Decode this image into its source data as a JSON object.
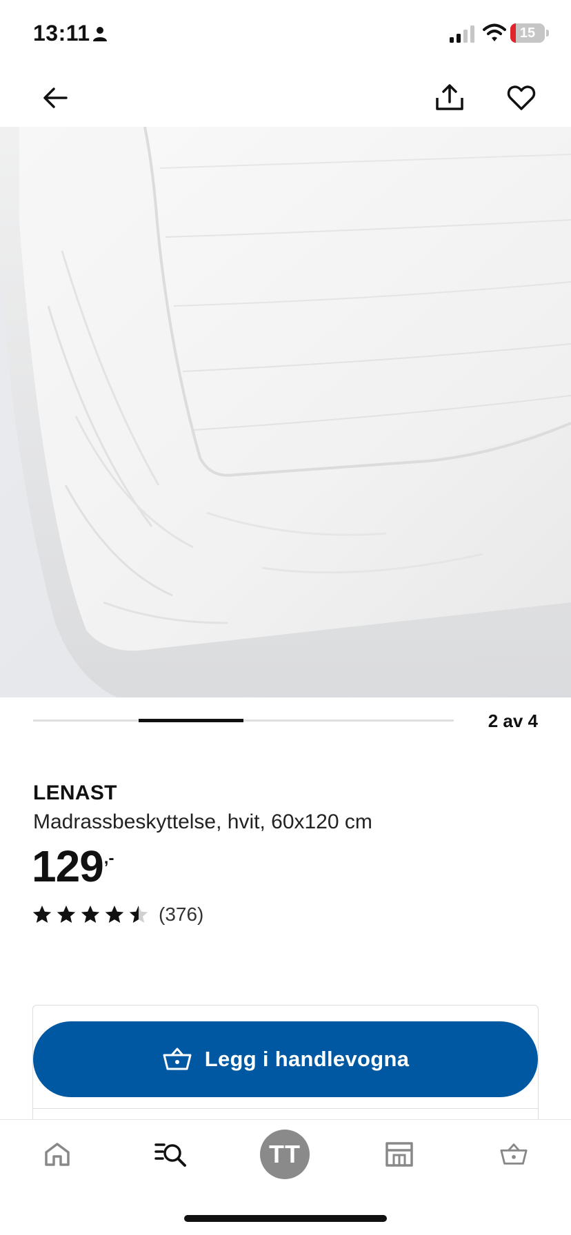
{
  "status_bar": {
    "time": "13:11",
    "battery_level": "15",
    "battery_fraction": 0.15,
    "battery_color": "#e0242b",
    "signal_bars": 2,
    "icons": [
      "person-icon",
      "signal-icon",
      "wifi-icon",
      "battery-icon"
    ]
  },
  "top_bar": {
    "icons": [
      "back-arrow-icon",
      "share-icon",
      "heart-icon"
    ]
  },
  "carousel": {
    "counter": "2 av 4",
    "current": 2,
    "total": 4
  },
  "product": {
    "name": "LENAST",
    "description": "Madrassbeskyttelse, hvit, 60x120 cm",
    "price_integer": "129",
    "price_decimal": ",-",
    "rating": 4.5,
    "review_count": "(376)"
  },
  "actions": {
    "add_to_cart_label": "Legg i handlevogna",
    "add_to_cart_icon": "shopping-basket-icon",
    "brand_color": "#0058a3"
  },
  "bottom_nav": {
    "items": [
      {
        "icon": "home-icon"
      },
      {
        "icon": "search-list-icon"
      },
      {
        "icon": "profile-avatar",
        "initials": "TT"
      },
      {
        "icon": "store-icon"
      },
      {
        "icon": "cart-basket-icon"
      }
    ]
  }
}
